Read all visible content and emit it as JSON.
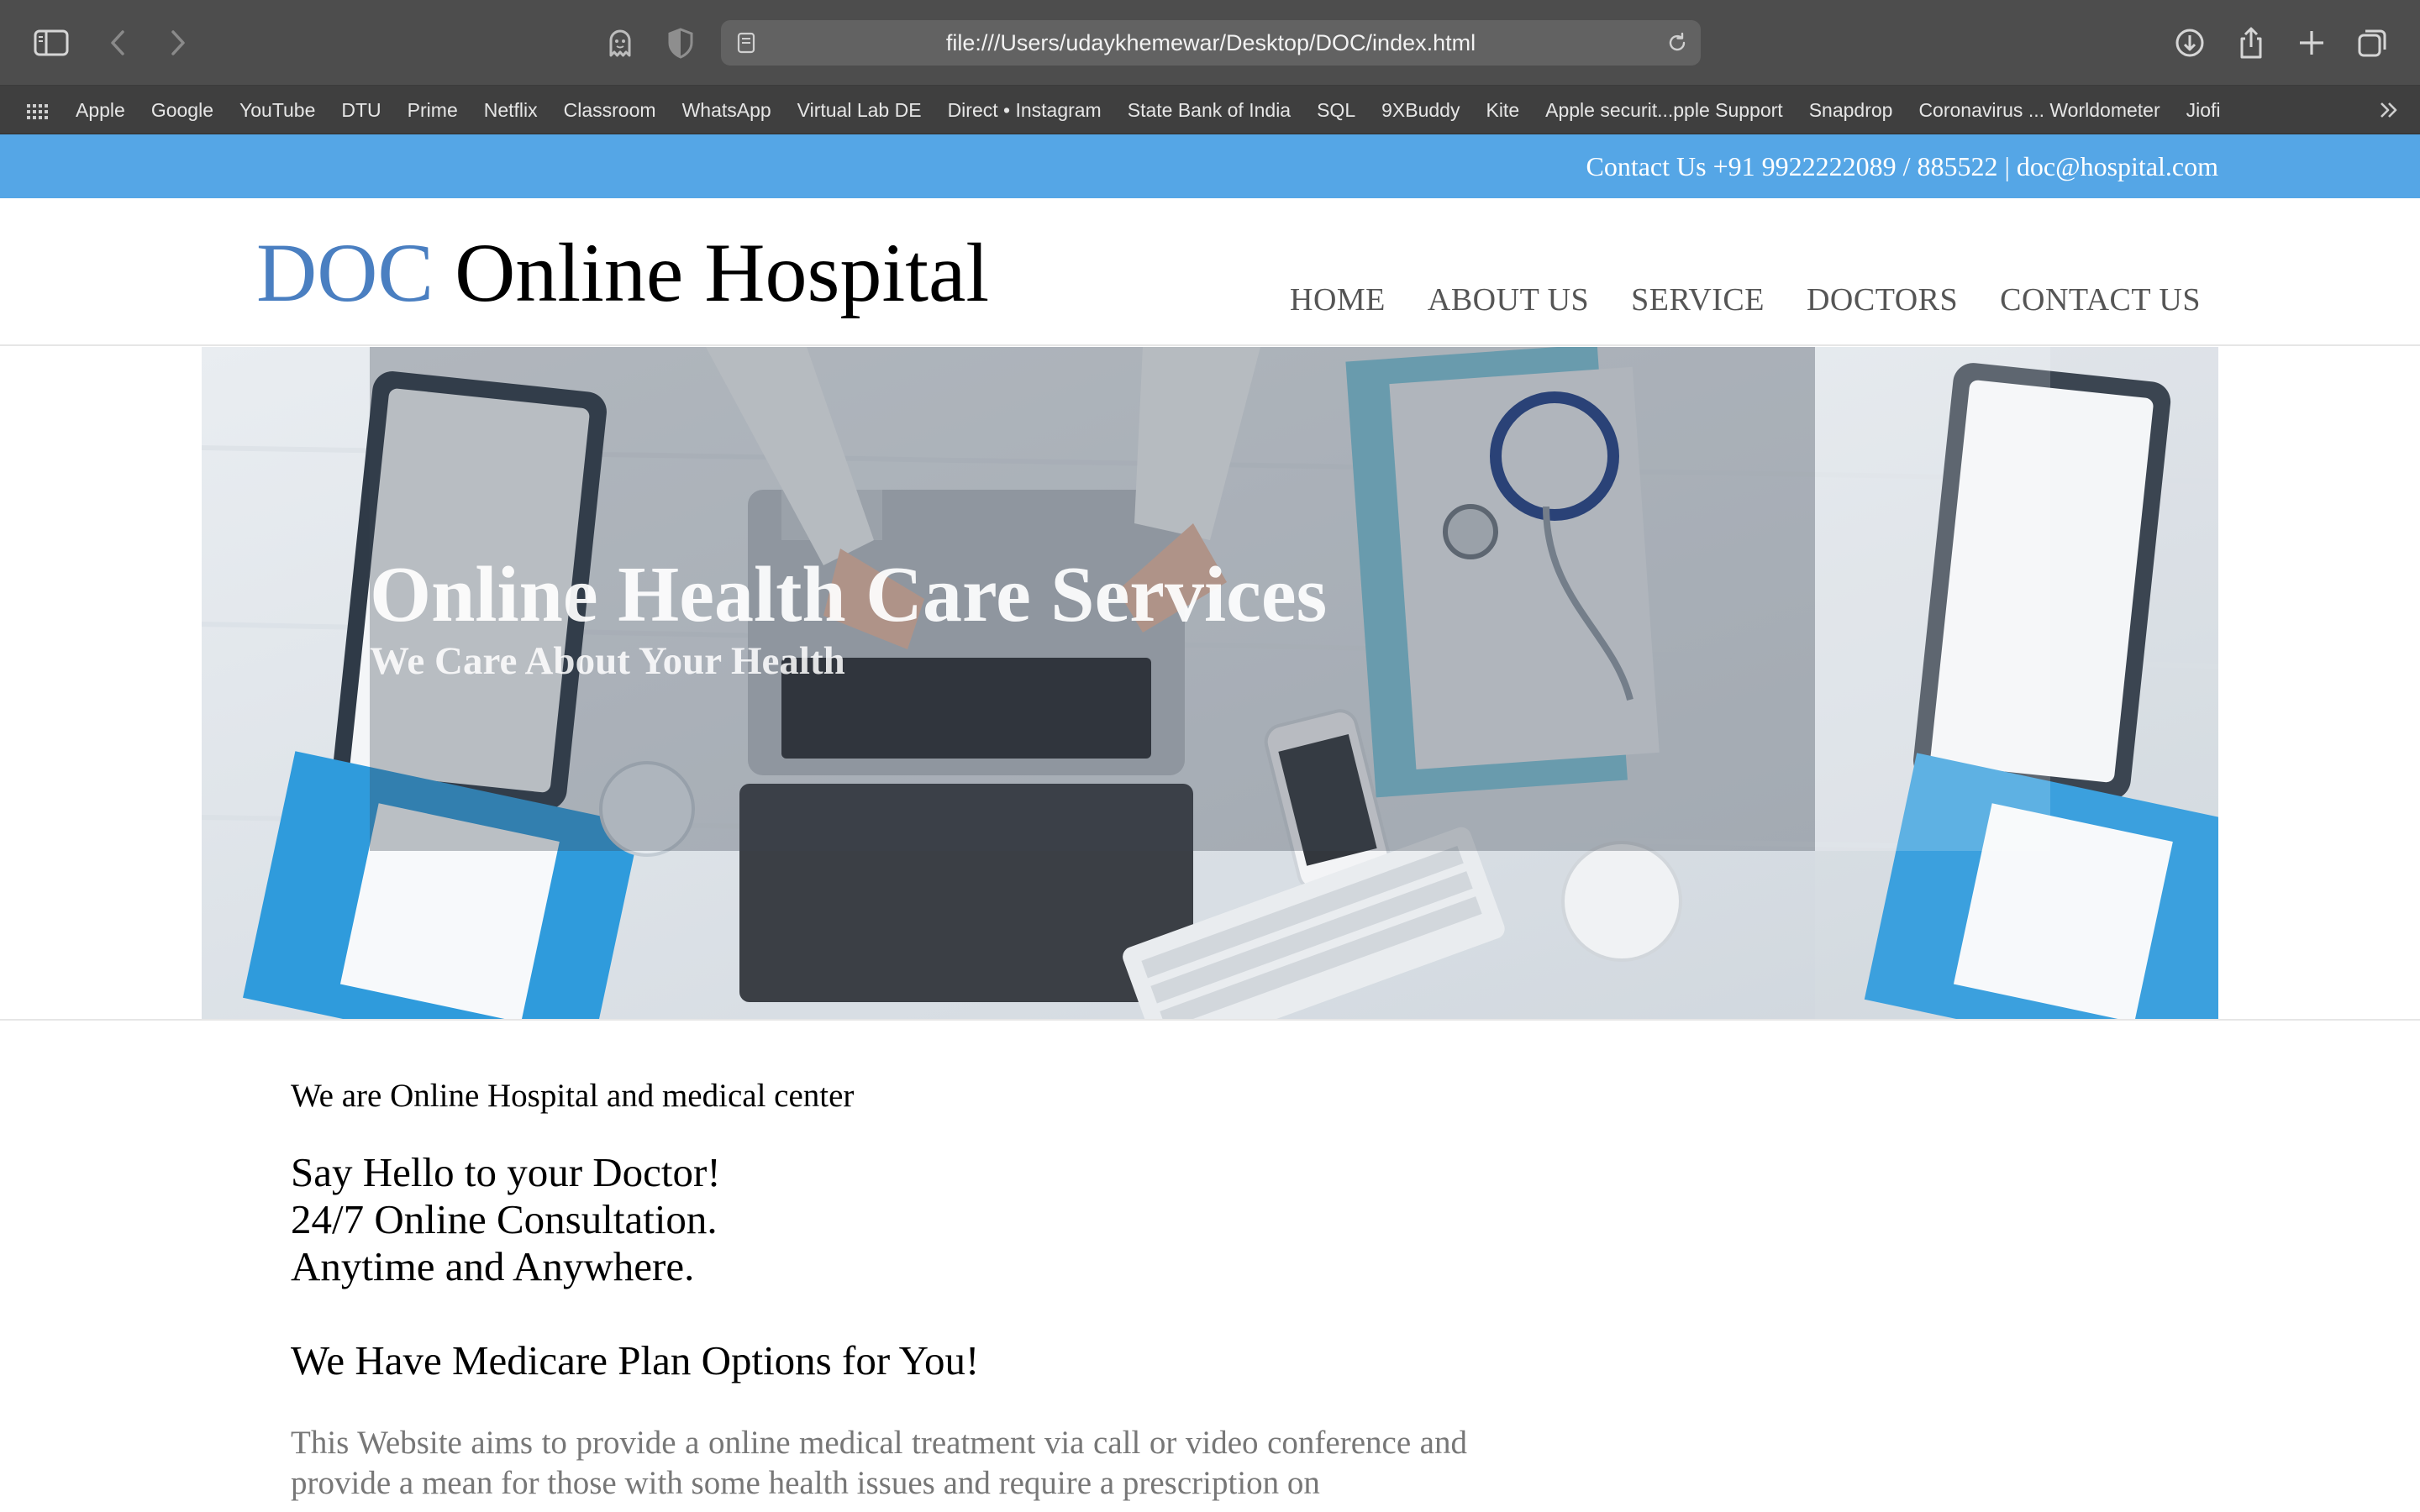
{
  "browser": {
    "url": "file:///Users/udaykhemewar/Desktop/DOC/index.html",
    "icons": {
      "sidebar": "sidebar-icon",
      "back": "back-arrow-icon",
      "forward": "forward-arrow-icon",
      "privacy": "ghost-icon",
      "shield": "shield-icon",
      "page": "page-icon",
      "reload": "reload-icon",
      "download": "download-icon",
      "share": "share-icon",
      "new_tab": "plus-icon",
      "tabs": "tab-overview-icon",
      "grid": "grid-icon",
      "more": "chevrons-right-icon"
    },
    "bookmarks": [
      "Apple",
      "Google",
      "YouTube",
      "DTU",
      "Prime",
      "Netflix",
      "Classroom",
      "WhatsApp",
      "Virtual Lab DE",
      "Direct • Instagram",
      "State Bank of India",
      "SQL",
      "9XBuddy",
      "Kite",
      "Apple securit...pple Support",
      "Snapdrop",
      "Coronavirus ... Worldometer",
      "Jiofi"
    ]
  },
  "topbar": {
    "contact": "Contact Us +91 9922222089 / 885522 | doc@hospital.com"
  },
  "header": {
    "brand_accent": "DOC",
    "brand_rest": " Online Hospital",
    "nav": [
      "HOME",
      "ABOUT US",
      "SERVICE",
      "DOCTORS",
      "CONTACT US"
    ]
  },
  "hero": {
    "title": "Online Health Care Services",
    "subtitle": "We Care About Your Health"
  },
  "content": {
    "intro": "We are Online Hospital and medical center",
    "hello_lines": [
      "Say Hello to your Doctor!",
      "24/7 Online Consultation.",
      "Anytime and Anywhere."
    ],
    "plans": "We Have Medicare Plan Options for You!",
    "description": "This Website aims to provide a online medical treatment via call or video conference and provide a mean for those with some health issues and require a prescription on"
  },
  "colors": {
    "topbar": "#55a6e6",
    "brand_accent": "#4a7fc1",
    "nav_text": "#555555",
    "desc_text": "#777777",
    "chrome_toolbar": "#4d4d4d",
    "chrome_bookmarks": "#3f3f3f"
  }
}
